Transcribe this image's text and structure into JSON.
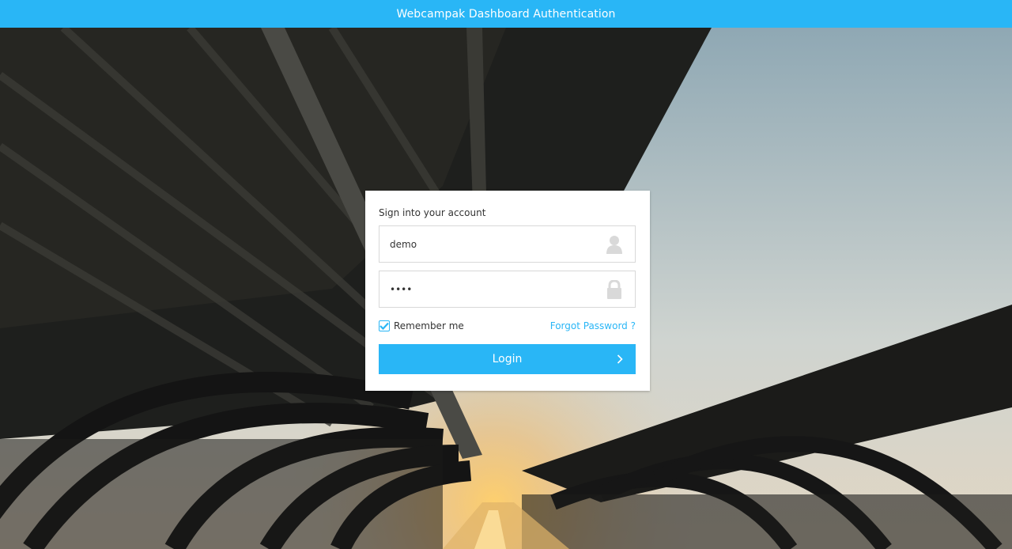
{
  "header": {
    "title": "Webcampak Dashboard Authentication"
  },
  "login": {
    "heading": "Sign into your account",
    "username_value": "demo",
    "password_value": "demo",
    "remember_label": "Remember me",
    "remember_checked": true,
    "forgot_label": "Forgot Password ?",
    "login_label": "Login"
  },
  "icons": {
    "username": "user-icon",
    "password": "lock-icon",
    "login": "chevron-right-icon",
    "remember": "check-icon"
  },
  "colors": {
    "accent": "#29b6f6",
    "card_bg": "#ffffff",
    "text": "#333333",
    "placeholder_icon": "#d9d9d9"
  }
}
